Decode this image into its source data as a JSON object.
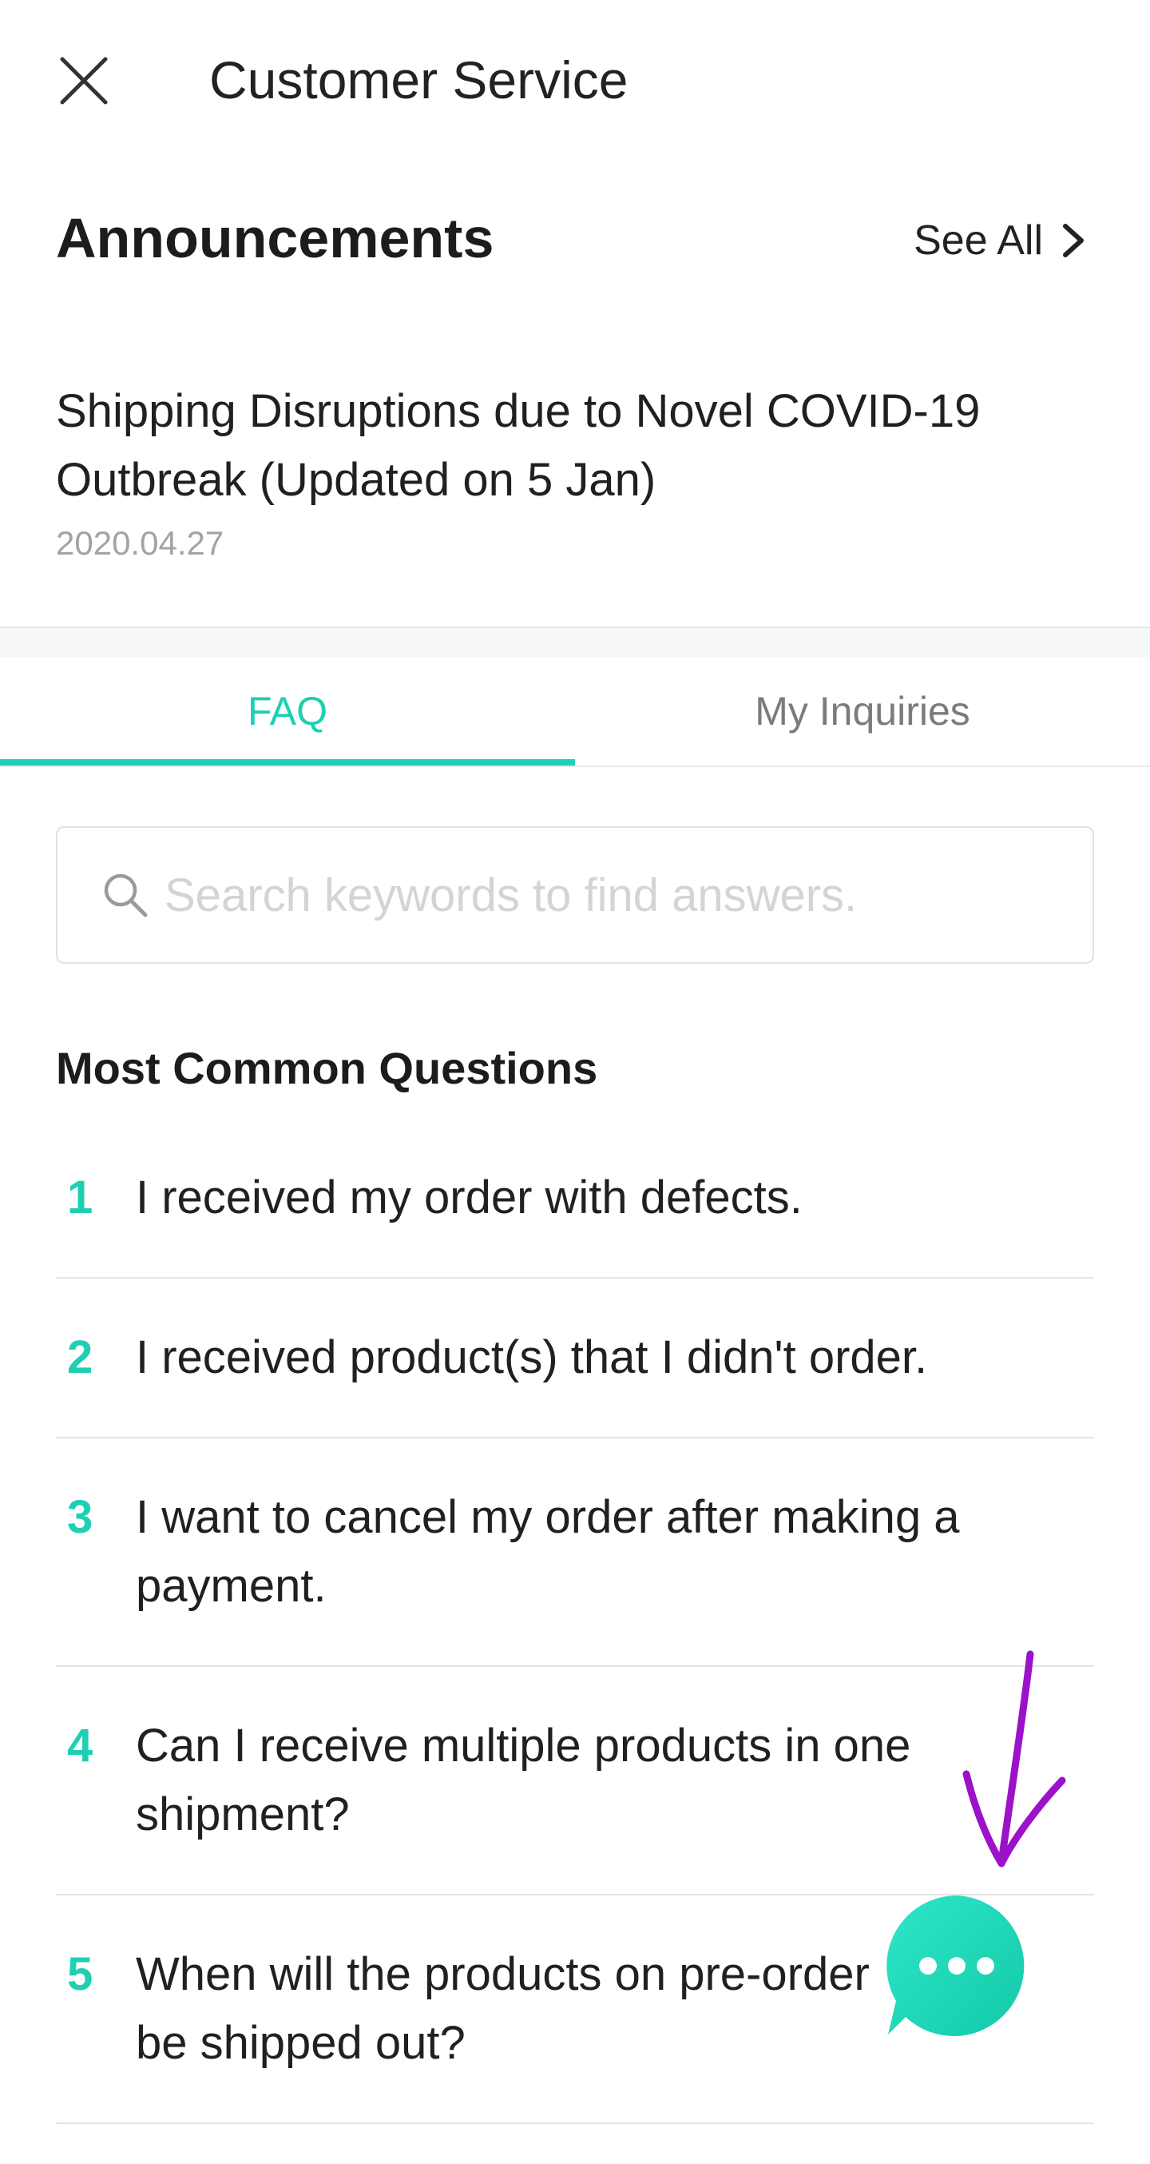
{
  "header": {
    "title": "Customer Service",
    "close_icon": "close-icon"
  },
  "announcements": {
    "heading": "Announcements",
    "see_all_label": "See All",
    "items": [
      {
        "title": "Shipping Disruptions due to Novel COVID-19 Outbreak (Updated on 5 Jan)",
        "date": "2020.04.27"
      }
    ]
  },
  "tabs": {
    "items": [
      {
        "label": "FAQ",
        "active": true
      },
      {
        "label": "My Inquiries",
        "active": false
      }
    ]
  },
  "search": {
    "placeholder": "Search keywords to find answers.",
    "value": "",
    "icon": "search-icon"
  },
  "questions": {
    "heading": "Most Common Questions",
    "items": [
      {
        "number": "1",
        "text": "I received my order with defects."
      },
      {
        "number": "2",
        "text": "I received product(s) that I didn't order."
      },
      {
        "number": "3",
        "text": "I want to cancel my order after making a payment."
      },
      {
        "number": "4",
        "text": "Can I receive multiple products in one shipment?"
      },
      {
        "number": "5",
        "text": "When will the products on pre-order be shipped out?"
      }
    ]
  },
  "chat": {
    "icon": "chat-bubble-icon"
  },
  "colors": {
    "accent": "#1ecfb4",
    "annotation": "#9b12c9",
    "text_primary": "#202020",
    "text_muted": "#a3a3a3"
  }
}
